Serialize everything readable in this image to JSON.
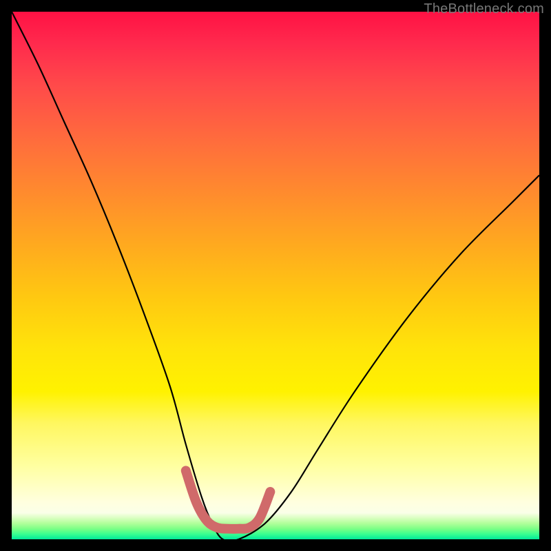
{
  "watermark": "TheBottleneck.com",
  "chart_data": {
    "type": "line",
    "title": "",
    "xlabel": "",
    "ylabel": "",
    "xlim": [
      0,
      100
    ],
    "ylim": [
      0,
      100
    ],
    "grid": false,
    "series": [
      {
        "name": "bottleneck-curve",
        "color": "#000000",
        "x": [
          0,
          5,
          10,
          15,
          20,
          25,
          30,
          33,
          36,
          38,
          40,
          43,
          48,
          53,
          58,
          65,
          75,
          85,
          95,
          100
        ],
        "y": [
          100,
          90,
          79,
          68,
          56,
          43,
          29,
          18,
          8,
          3,
          0,
          0,
          3,
          9,
          17,
          28,
          42,
          54,
          64,
          69
        ]
      },
      {
        "name": "optimal-range-marker",
        "color": "#d06a6a",
        "x": [
          33,
          35,
          37,
          39,
          41,
          43,
          45,
          47,
          49
        ],
        "y": [
          13,
          7,
          3.5,
          2.2,
          2,
          2,
          2.2,
          4,
          9
        ]
      }
    ],
    "annotations": []
  }
}
